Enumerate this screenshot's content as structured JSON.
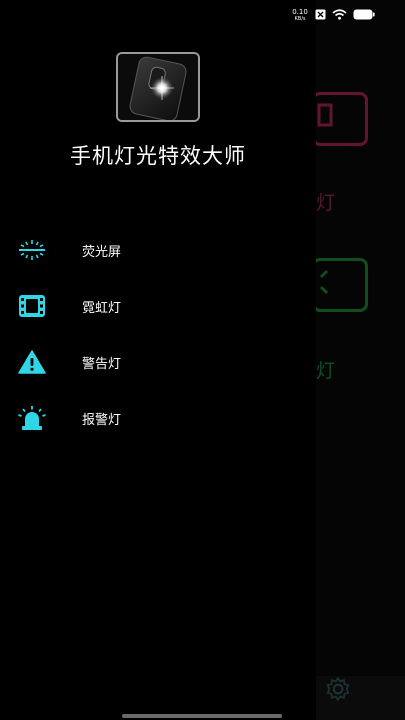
{
  "status_bar": {
    "net_speed_value": "0.10",
    "net_speed_unit": "KB/s",
    "icons": [
      "data-icon",
      "wifi-icon",
      "battery-icon"
    ]
  },
  "drawer": {
    "app_icon": "flashlight-phone-icon",
    "app_title": "手机灯光特效大师",
    "menu": [
      {
        "label": "荧光屏",
        "icon": "glow-screen-icon"
      },
      {
        "label": "霓虹灯",
        "icon": "film-icon"
      },
      {
        "label": "警告灯",
        "icon": "warning-icon"
      },
      {
        "label": "报警灯",
        "icon": "alarm-light-icon"
      }
    ]
  },
  "background": {
    "label_1": "灯",
    "label_2": "灯",
    "bottom_icon": "gear-icon"
  },
  "colors": {
    "accent": "#2fd6e6",
    "pink": "#ff3b7a",
    "green": "#2fe05a",
    "drawer_bg": "#000000"
  }
}
